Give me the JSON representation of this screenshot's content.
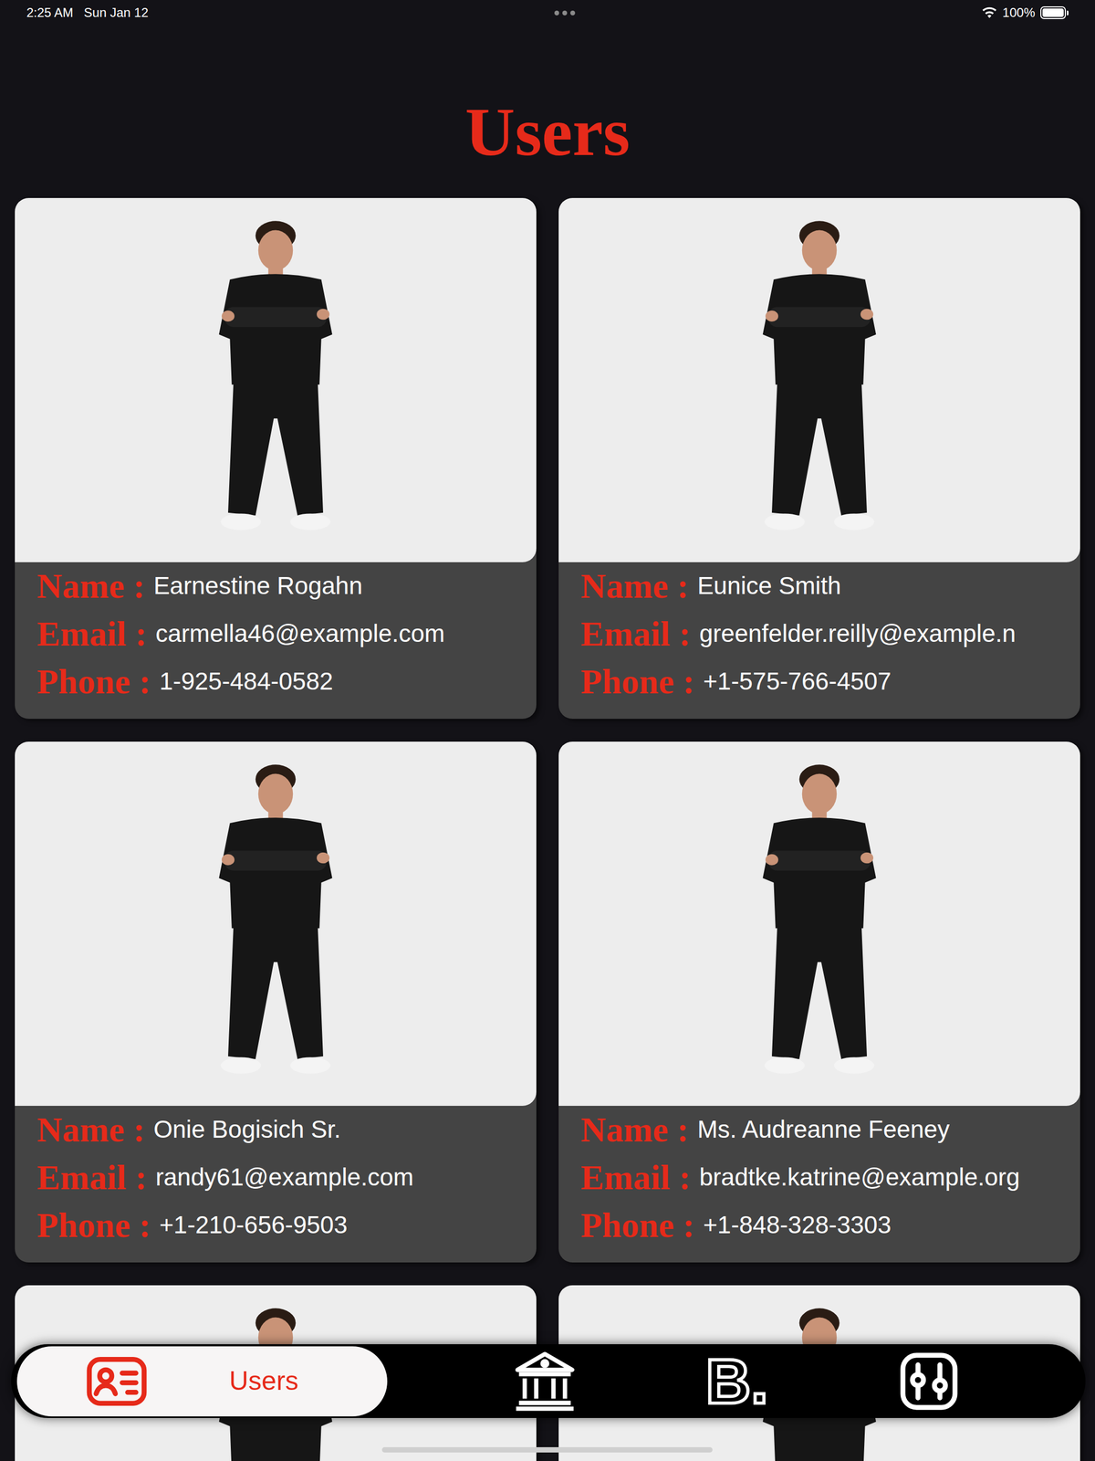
{
  "status_bar": {
    "time": "2:25 AM",
    "date": "Sun Jan 12",
    "battery": "100%",
    "battery_level": 1
  },
  "title": "Users",
  "labels": {
    "name": "Name :",
    "email": "Email :",
    "phone": "Phone :"
  },
  "users": [
    {
      "partial": false,
      "name": "Earnestine Rogahn",
      "email": "carmella46@example.com",
      "phone": "1-925-484-0582"
    },
    {
      "partial": false,
      "name": "Eunice Smith",
      "email": "greenfelder.reilly@example.n",
      "phone": "+1-575-766-4507"
    },
    {
      "partial": false,
      "name": "Onie Bogisich Sr.",
      "email": "randy61@example.com",
      "phone": "+1-210-656-9503"
    },
    {
      "partial": false,
      "name": "Ms. Audreanne Feeney",
      "email": "bradtke.katrine@example.org",
      "phone": "+1-848-328-3303"
    },
    {
      "partial": true
    },
    {
      "partial": true
    }
  ],
  "nav": [
    {
      "kind": "users",
      "label": "Users",
      "selected": true
    },
    {
      "kind": "bank",
      "selected": false
    },
    {
      "kind": "brand",
      "glyph": "B.",
      "selected": false
    },
    {
      "kind": "sliders",
      "selected": false
    }
  ]
}
